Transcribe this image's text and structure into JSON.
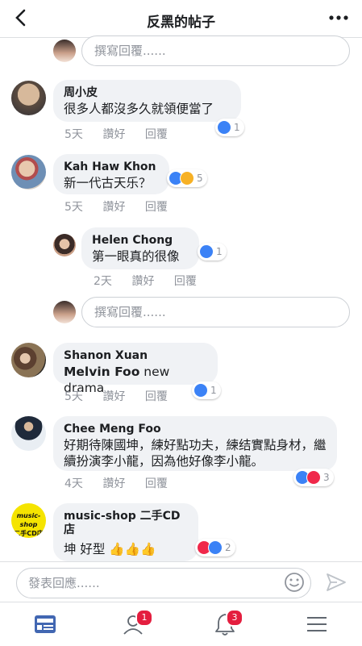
{
  "header": {
    "title": "反黑的帖子",
    "back_icon": "chevron-left-icon",
    "more_icon": "more-dots-icon"
  },
  "reply_placeholder": "撰寫回覆......",
  "comments": [
    {
      "name": "周小皮",
      "text": "很多人都沒多久就領便當了",
      "time": "5天",
      "like_label": "讚好",
      "reply_label": "回覆",
      "reactions": [
        "like"
      ],
      "count": "1"
    },
    {
      "name": "Kah Haw Khon",
      "text": "新一代古天乐？",
      "time": "5天",
      "like_label": "讚好",
      "reply_label": "回覆",
      "reactions": [
        "like",
        "haha"
      ],
      "count": "5"
    },
    {
      "name": "Helen Chong",
      "text": "第一眼真的很像",
      "time": "2天",
      "like_label": "讚好",
      "reply_label": "回覆",
      "reactions": [
        "like"
      ],
      "count": "1"
    },
    {
      "name": "Shanon Xuan",
      "mention": "Melvin Foo",
      "text": " new drama",
      "time": "5天",
      "like_label": "讚好",
      "reply_label": "回覆",
      "reactions": [
        "like"
      ],
      "count": "1"
    },
    {
      "name": "Chee Meng Foo",
      "text": "好期待陳國坤，練好點功夫，練结實點身材，繼續扮演李小龍，因為他好像李小龍。",
      "time": "4天",
      "like_label": "讚好",
      "reply_label": "回覆",
      "reactions": [
        "like",
        "love"
      ],
      "count": "3"
    },
    {
      "name": "music-shop 二手CD店",
      "text": "坤 好型 👍👍👍",
      "text2": "。",
      "reactions": [
        "love",
        "like"
      ],
      "count": "2",
      "avatar_text1": "music-shop",
      "avatar_text2": "二手CD店"
    }
  ],
  "composer": {
    "placeholder": "發表回應......",
    "emoji_icon": "smiley-icon",
    "send_icon": "send-icon"
  },
  "tabbar": {
    "items": [
      {
        "icon": "news-feed-icon",
        "badge": ""
      },
      {
        "icon": "friends-icon",
        "badge": "1"
      },
      {
        "icon": "bell-icon",
        "badge": "3"
      },
      {
        "icon": "menu-icon",
        "badge": ""
      }
    ]
  },
  "colors": {
    "accent": "#4267b2",
    "badge": "#e41e3f",
    "like": "#3b82f6",
    "love": "#f0284a",
    "bubble": "#f0f2f5"
  }
}
